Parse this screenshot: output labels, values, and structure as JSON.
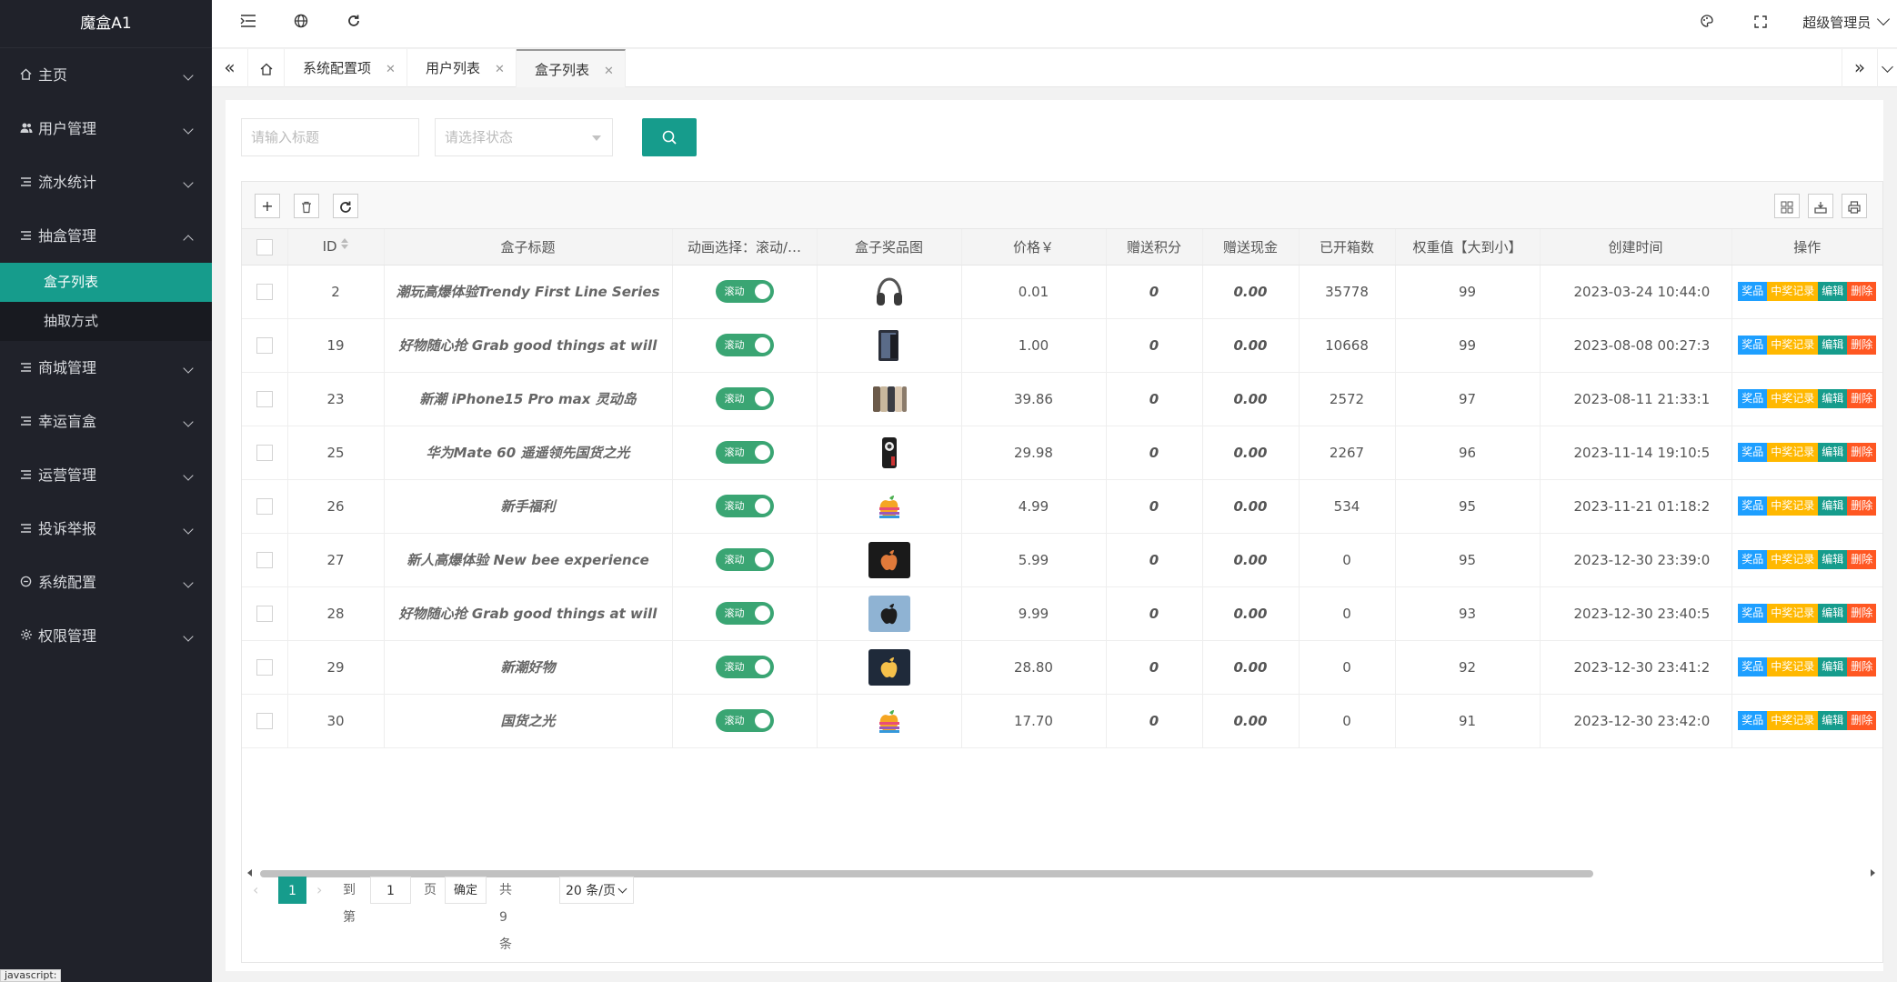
{
  "app": {
    "logo": "魔盒A1"
  },
  "sidebar": {
    "items": [
      {
        "label": "主页",
        "icon": "home-icon"
      },
      {
        "label": "用户管理",
        "icon": "users-icon"
      },
      {
        "label": "流水统计",
        "icon": "list-icon"
      },
      {
        "label": "抽盒管理",
        "icon": "list-icon",
        "open": true,
        "children": [
          {
            "label": "盒子列表",
            "active": true
          },
          {
            "label": "抽取方式"
          }
        ]
      },
      {
        "label": "商城管理",
        "icon": "list-icon"
      },
      {
        "label": "幸运盲盒",
        "icon": "list-icon"
      },
      {
        "label": "运营管理",
        "icon": "list-icon"
      },
      {
        "label": "投诉举报",
        "icon": "list-icon"
      },
      {
        "label": "系统配置",
        "icon": "cycle-icon"
      },
      {
        "label": "权限管理",
        "icon": "gear-icon"
      }
    ]
  },
  "topbar": {
    "admin": "超级管理员"
  },
  "tabs": [
    {
      "label": "系统配置项"
    },
    {
      "label": "用户列表"
    },
    {
      "label": "盒子列表",
      "active": true
    }
  ],
  "filter": {
    "title_placeholder": "请输入标题",
    "status_placeholder": "请选择状态"
  },
  "table": {
    "headers": [
      "ID",
      "盒子标题",
      "动画选择：滚动/…",
      "盒子奖品图",
      "价格￥",
      "赠送积分",
      "赠送现金",
      "已开箱数",
      "权重值【大到小】",
      "创建时间",
      "操作"
    ],
    "actions": [
      "奖品",
      "中奖记录",
      "编辑",
      "删除"
    ],
    "switch_label": "滚动",
    "rows": [
      {
        "id": "2",
        "title": "潮玩高爆体验Trendy First Line Series",
        "price": "0.01",
        "points": "0",
        "cash": "0.00",
        "opened": "35778",
        "weight": "99",
        "created": "2023-03-24 10:44:0",
        "img": "headphones"
      },
      {
        "id": "19",
        "title": "好物随心抢 Grab good things at will",
        "price": "1.00",
        "points": "0",
        "cash": "0.00",
        "opened": "10668",
        "weight": "99",
        "created": "2023-08-08 00:27:3",
        "img": "tablet"
      },
      {
        "id": "23",
        "title": "新潮 iPhone15 Pro max 灵动岛",
        "price": "39.86",
        "points": "0",
        "cash": "0.00",
        "opened": "2572",
        "weight": "97",
        "created": "2023-08-11 21:33:1",
        "img": "phones"
      },
      {
        "id": "25",
        "title": "华为Mate 60 遥遥领先国货之光",
        "price": "29.98",
        "points": "0",
        "cash": "0.00",
        "opened": "2267",
        "weight": "96",
        "created": "2023-11-14 19:10:5",
        "img": "mate"
      },
      {
        "id": "26",
        "title": "新手福利",
        "price": "4.99",
        "points": "0",
        "cash": "0.00",
        "opened": "534",
        "weight": "95",
        "created": "2023-11-21 01:18:2",
        "img": "apple-color"
      },
      {
        "id": "27",
        "title": "新人高爆体验 New bee experience",
        "price": "5.99",
        "points": "0",
        "cash": "0.00",
        "opened": "0",
        "weight": "95",
        "created": "2023-12-30 23:39:0",
        "img": "apple-dark"
      },
      {
        "id": "28",
        "title": "好物随心抢 Grab good things at will",
        "price": "9.99",
        "points": "0",
        "cash": "0.00",
        "opened": "0",
        "weight": "93",
        "created": "2023-12-30 23:40:5",
        "img": "apple-blue"
      },
      {
        "id": "29",
        "title": "新潮好物",
        "price": "28.80",
        "points": "0",
        "cash": "0.00",
        "opened": "0",
        "weight": "92",
        "created": "2023-12-30 23:41:2",
        "img": "apple-fire"
      },
      {
        "id": "30",
        "title": "国货之光",
        "price": "17.70",
        "points": "0",
        "cash": "0.00",
        "opened": "0",
        "weight": "91",
        "created": "2023-12-30 23:42:0",
        "img": "apple-color"
      }
    ]
  },
  "pager": {
    "current": "1",
    "goto": "到第",
    "page_input": "1",
    "page_unit": "页",
    "confirm": "确定",
    "total": "共 9 条",
    "per_page": "20 条/页"
  },
  "status_bar": "javascript:",
  "colors": {
    "sidebar_bg": "#20222a",
    "accent": "#169c8c",
    "switch": "#3aa573",
    "btn_blue": "#1e9fff",
    "btn_orange": "#ffb800",
    "btn_red": "#ff5722"
  }
}
